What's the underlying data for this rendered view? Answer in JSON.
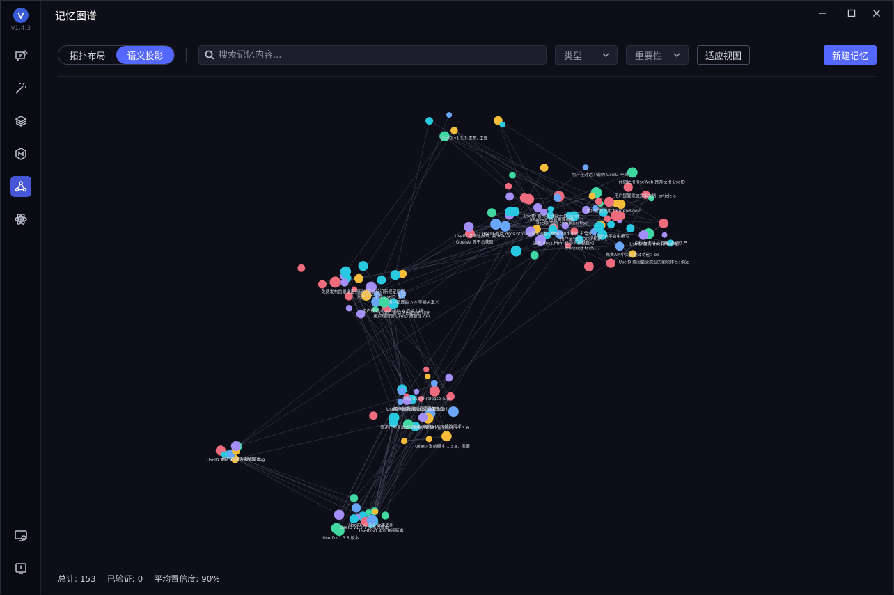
{
  "app": {
    "title": "记忆图谱",
    "version": "v1.4.3"
  },
  "sidebar": {
    "items": [
      {
        "icon": "chat-sparkle-icon"
      },
      {
        "icon": "magic-wand-icon"
      },
      {
        "icon": "layers-icon"
      },
      {
        "icon": "model-m-icon"
      },
      {
        "icon": "memory-graph-icon",
        "active": true
      },
      {
        "icon": "atom-icon"
      },
      {
        "icon": "settings-screen-icon"
      },
      {
        "icon": "info-icon"
      }
    ]
  },
  "toolbar": {
    "layout_topology": "拓扑布局",
    "layout_semantic": "语义投影",
    "search_placeholder": "搜索记忆内容...",
    "type_select": "类型",
    "importance_select": "重要性",
    "fit_view": "适应视图",
    "new_memory": "新建记忆"
  },
  "colors": {
    "blue": "#6aa6f8",
    "purple": "#a48ef6",
    "yellow": "#f6bd3a",
    "red": "#ef6b7e",
    "cyan": "#28c9e0",
    "green": "#3ed8a0",
    "accent": "#5468ff"
  },
  "graph": {
    "labels": [
      "UseID 查阅 computerUse",
      "UseID 查阅最受欢迎的前项排名: 确定",
      "UseID 查阅项目位于 D:\\work",
      "用户计划使用 frontend-gold",
      "frontend-tech ...",
      "用户运行的 Quantum ...",
      "用户提醒添加文本文档: article-a",
      "用户在对话中说明 UseID 平台",
      "UseID 查阅 docs.html 已导入调整自动",
      "GitWatt 平台发布 UseID 产",
      "完整 docs.html 已导入调整自动",
      "免费API中英文翻译功能：ok",
      "已在免费API平台中编写",
      "OpenAI 等平台获取",
      "UseID 请描述报错, 要 free-a",
      "UseID 查阅 docs.html 前",
      "frontend-dev 主分支",
      "README 技能需要调整",
      "计划使用 UseWeb 推荐使用 UseID",
      "用户工作环境 UseID 重力",
      "用户规则使 UseID 重要性 API",
      "用户规划 UseID EULA 已经上线",
      "免费发布的跟道跟到现代实验标识新规定层面",
      "用户配置的 API 等相关定义",
      "UseID 查阅 README 和在",
      "privacy/eula 页面已加入",
      "添加 UseID release 公开",
      "UseID 当前版本 1.3.8，需要",
      "UseID 查阅的版本文件 src.html",
      "传递在项目版本 v1.4.0 更新",
      "添加 UseID 最新版本 v1.3.6",
      "用户配置语言 CN 请求完成",
      "UseID 查阅 EULA 修改需求",
      "UseID v1.3.9 版本更新",
      "UseID v1.3.7 发布的版本",
      "UseID v1.4.0 查阅版本",
      "UseID v1.3.5 版本",
      "UseID 查阅 v1.3.9 发布版本",
      "用户在对话中发现 Bug",
      "UseID v1.3.1 发布, 主要"
    ]
  },
  "stats": {
    "total": "总计: 153",
    "verified": "已验证: 0",
    "avg_confidence": "平均置信度: 90%"
  }
}
